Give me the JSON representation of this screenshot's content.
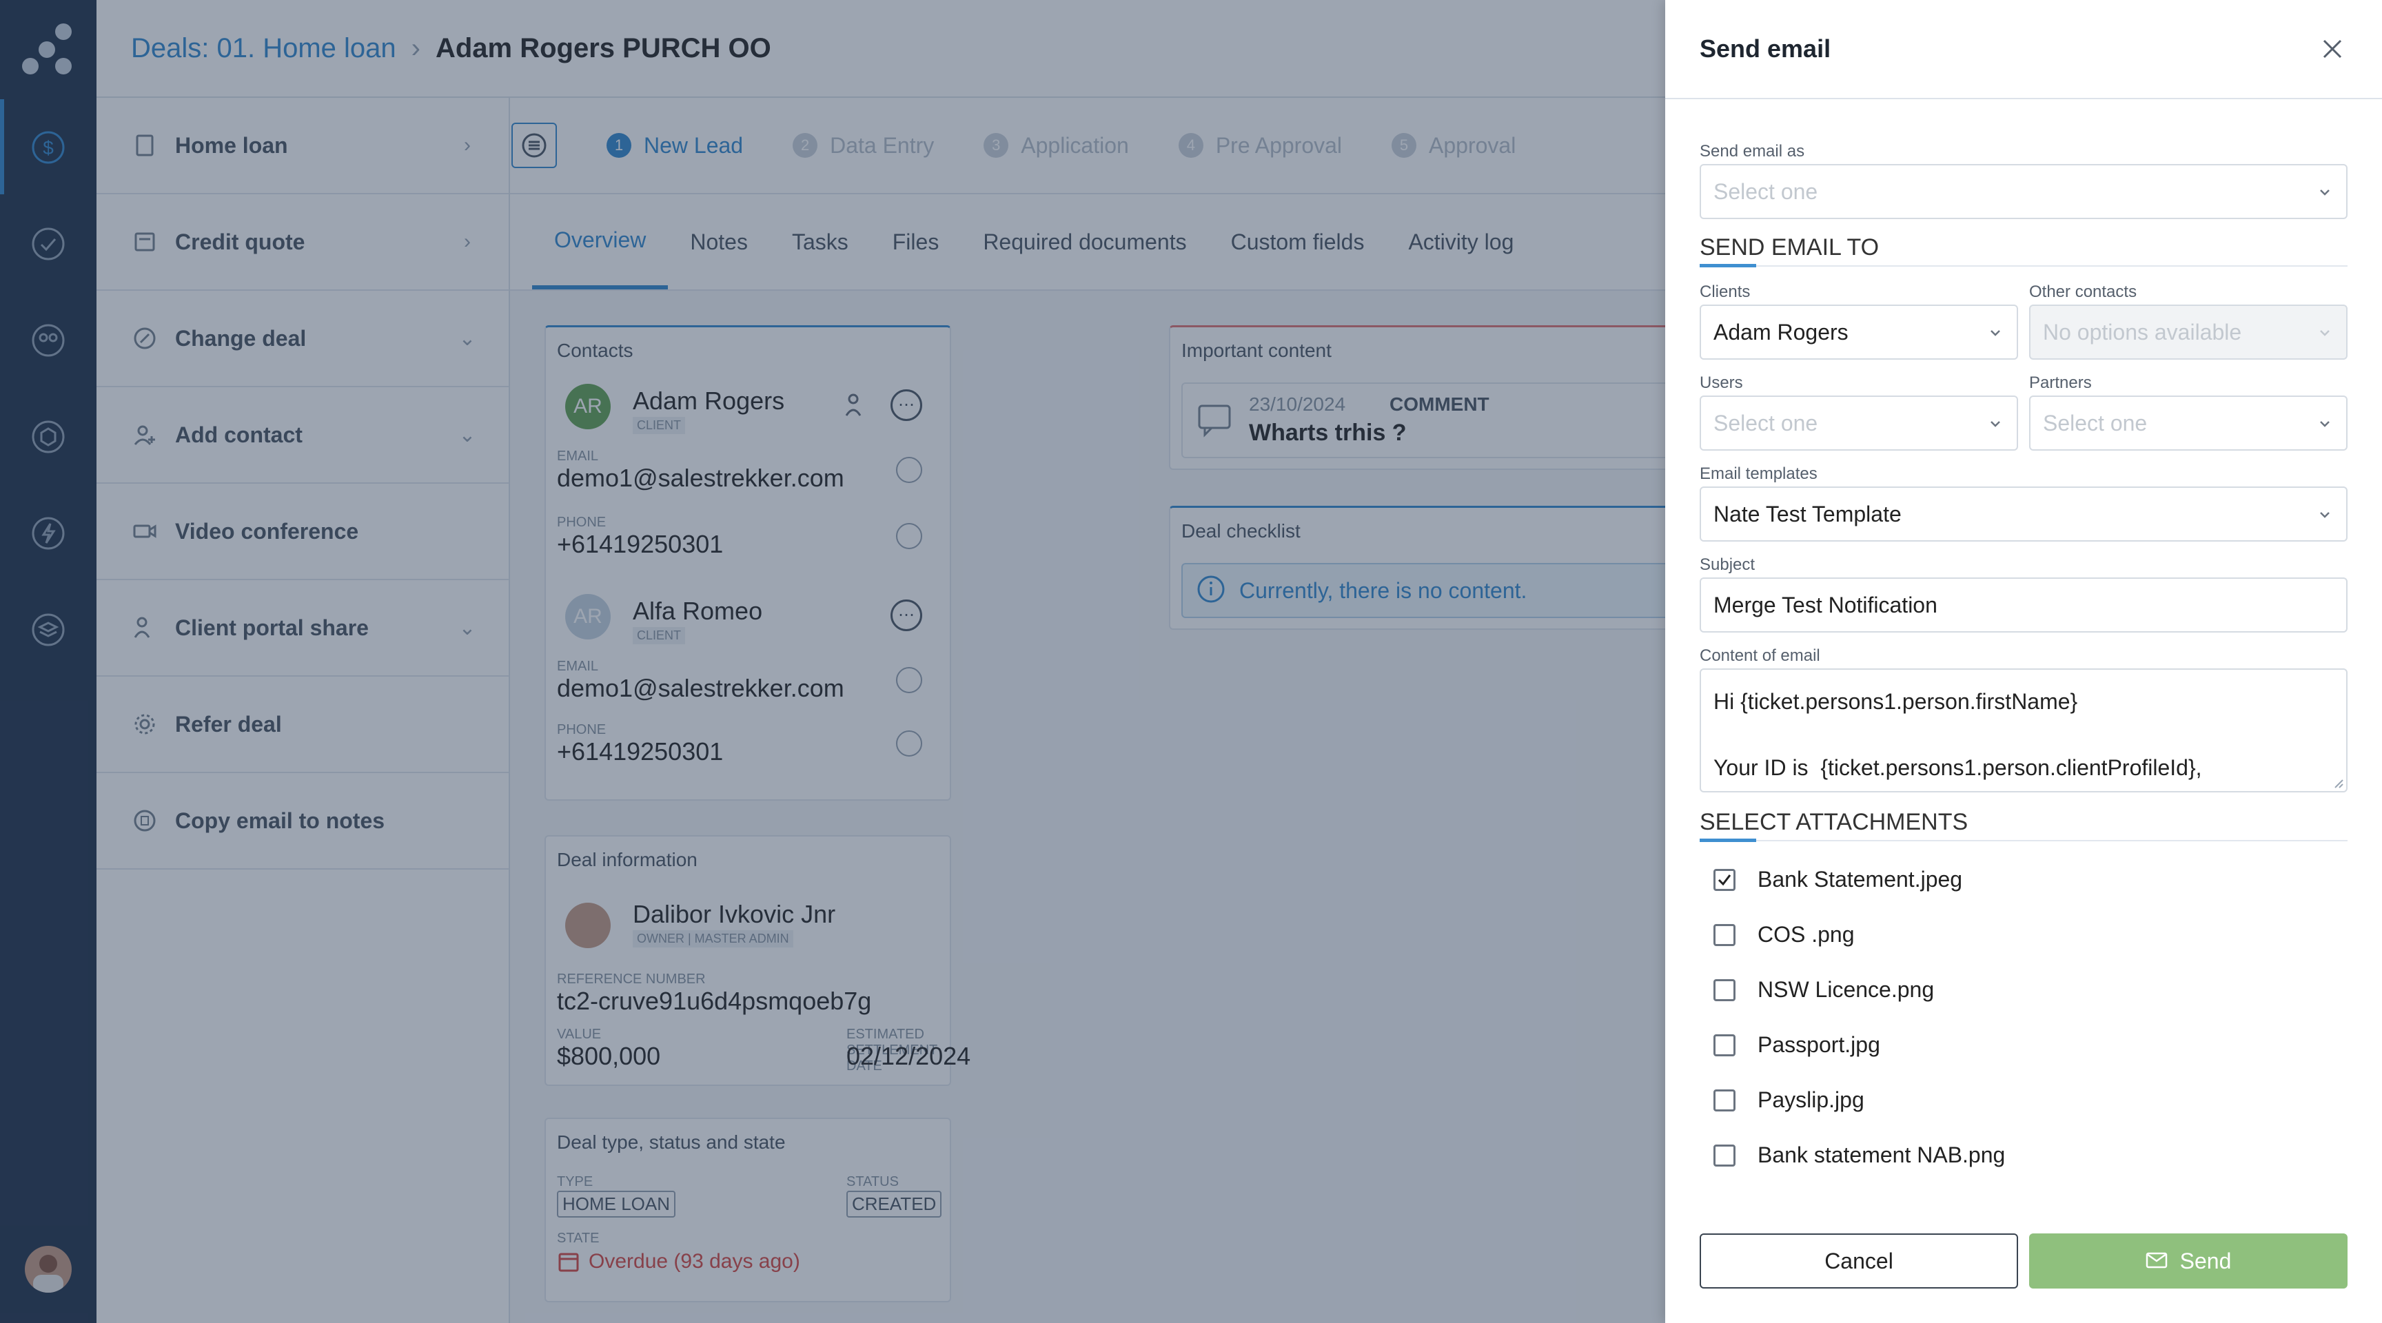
{
  "breadcrumb": {
    "parent": "Deals: 01. Home loan",
    "current": "Adam Rogers PURCH OO"
  },
  "sidebar_actions": [
    {
      "label": "Home loan",
      "chevron": "›"
    },
    {
      "label": "Credit quote",
      "chevron": "›"
    },
    {
      "label": "Change deal",
      "chevron": "⌄"
    },
    {
      "label": "Add contact",
      "chevron": "⌄"
    },
    {
      "label": "Video conference",
      "chevron": ""
    },
    {
      "label": "Client portal share",
      "chevron": "⌄"
    },
    {
      "label": "Refer deal",
      "chevron": ""
    },
    {
      "label": "Copy email to notes",
      "chevron": ""
    }
  ],
  "steps": [
    {
      "num": "1",
      "label": "New Lead"
    },
    {
      "num": "2",
      "label": "Data Entry"
    },
    {
      "num": "3",
      "label": "Application"
    },
    {
      "num": "4",
      "label": "Pre Approval"
    },
    {
      "num": "5",
      "label": "Approval"
    }
  ],
  "tabs": [
    "Overview",
    "Notes",
    "Tasks",
    "Files",
    "Required documents",
    "Custom fields",
    "Activity log"
  ],
  "contacts_card": {
    "title": "Contacts",
    "contacts": [
      {
        "initials": "AR",
        "name": "Adam Rogers",
        "role": "CLIENT",
        "email_label": "EMAIL",
        "email": "demo1@salestrekker.com",
        "phone_label": "PHONE",
        "phone": "+61419250301"
      },
      {
        "initials": "AR",
        "name": "Alfa Romeo",
        "role": "CLIENT",
        "email_label": "EMAIL",
        "email": "demo1@salestrekker.com",
        "phone_label": "PHONE",
        "phone": "+61419250301"
      }
    ]
  },
  "important_card": {
    "title": "Important content",
    "date": "23/10/2024",
    "type": "COMMENT",
    "text": "Wharts trhis ?"
  },
  "checklist_card": {
    "title": "Deal checklist",
    "empty": "Currently, there is no content."
  },
  "deal_info_card": {
    "title": "Deal information",
    "owner": "Dalibor Ivkovic Jnr",
    "owner_role": "OWNER | MASTER ADMIN",
    "ref_label": "REFERENCE NUMBER",
    "ref": "tc2-cruve91u6d4psmqoeb7g",
    "value_label": "VALUE",
    "value": "$800,000",
    "settle_label": "ESTIMATED SETTLEMENT DATE",
    "settle": "02/12/2024"
  },
  "deal_type_card": {
    "title": "Deal type, status and state",
    "type_label": "TYPE",
    "type": "HOME LOAN",
    "status_label": "STATUS",
    "status": "CREATED",
    "state_label": "STATE",
    "state": "Overdue (93 days ago)"
  },
  "modal": {
    "title": "Send email",
    "send_as_label": "Send email as",
    "send_as_placeholder": "Select one",
    "send_to_heading": "SEND EMAIL TO",
    "clients_label": "Clients",
    "clients_value": "Adam Rogers",
    "other_contacts_label": "Other contacts",
    "other_contacts_placeholder": "No options available",
    "users_label": "Users",
    "users_placeholder": "Select one",
    "partners_label": "Partners",
    "partners_placeholder": "Select one",
    "templates_label": "Email templates",
    "templates_value": "Nate Test Template",
    "subject_label": "Subject",
    "subject_value": "Merge Test Notification",
    "content_label": "Content of email",
    "content_line1": "Hi {ticket.persons1.person.firstName}",
    "content_line2": "",
    "content_line3": "Your ID is  {ticket.persons1.person.clientProfileId},",
    "attachments_heading": "SELECT ATTACHMENTS",
    "attachments": [
      {
        "name": "Bank Statement.jpeg",
        "checked": true
      },
      {
        "name": "COS .png",
        "checked": false
      },
      {
        "name": "NSW Licence.png",
        "checked": false
      },
      {
        "name": "Passport.jpg",
        "checked": false
      },
      {
        "name": "Payslip.jpg",
        "checked": false
      },
      {
        "name": "Bank statement NAB.png",
        "checked": false
      }
    ],
    "cancel_label": "Cancel",
    "send_label": "Send"
  },
  "colors": {
    "accent": "#3f8fd0",
    "rail": "#2e3e55",
    "send": "#8fc07d",
    "overdue": "#d9534f"
  },
  "icons": [
    "logo-icon",
    "deals-icon",
    "check-icon",
    "contacts-icon",
    "box-icon",
    "lightning-icon",
    "layers-icon",
    "chevron-down-icon",
    "close-icon",
    "copy-icon",
    "more-icon",
    "mail-icon"
  ]
}
